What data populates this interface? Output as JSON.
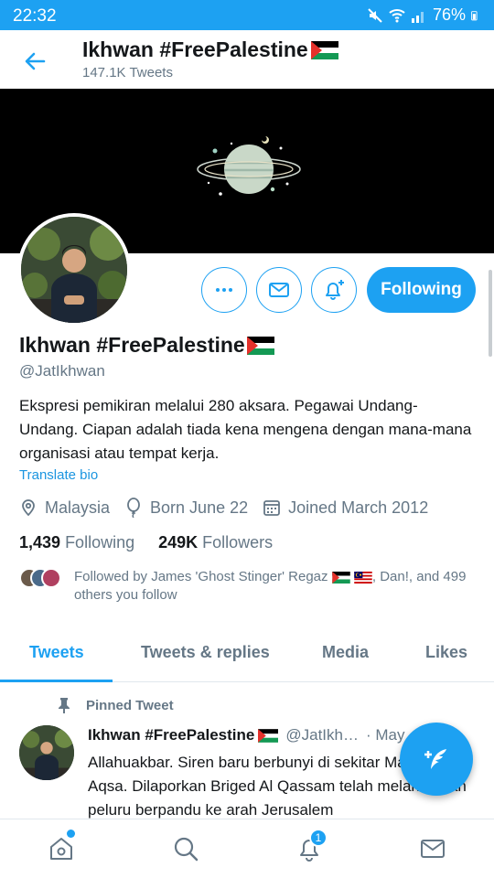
{
  "status_bar": {
    "time": "22:32",
    "battery": "76%"
  },
  "header": {
    "name": "Ikhwan #FreePalestine",
    "tweet_count": "147.1K Tweets"
  },
  "profile": {
    "name": "Ikhwan #FreePalestine",
    "handle": "@JatIkhwan",
    "bio": "Ekspresi pemikiran melalui 280 aksara. Pegawai Undang-Undang. Ciapan adalah tiada kena mengena dengan mana-mana organisasi atau tempat kerja.",
    "translate_label": "Translate bio",
    "location": "Malaysia",
    "birthday": "Born June 22",
    "joined": "Joined March 2012",
    "following_count": "1,439",
    "following_label": "Following",
    "followers_count": "249K",
    "followers_label": "Followers",
    "followed_by_prefix": "Followed by James 'Ghost Stinger' Regaz",
    "followed_by_suffix": ", Dan!, and 499 others you follow",
    "follow_button": "Following"
  },
  "tabs": [
    "Tweets",
    "Tweets & replies",
    "Media",
    "Likes"
  ],
  "pinned_tweet": {
    "label": "Pinned Tweet",
    "name": "Ikhwan #FreePalestine",
    "handle": "@JatIkh…",
    "date": "· May",
    "text": "Allahuakbar. Siren baru berbunyi di sekitar Masjid Al-Aqsa. Dilaporkan Briged Al Qassam telah melancarkan peluru berpandu ke arah Jerusalem"
  },
  "bottom_nav": {
    "notification_badge": "1"
  },
  "icons": {
    "back": "arrow-left-icon",
    "more": "more-horizontal-icon",
    "message": "envelope-icon",
    "notify": "bell-plus-icon",
    "location": "location-pin-icon",
    "birthday": "balloon-icon",
    "calendar": "calendar-icon",
    "pin": "pin-icon",
    "compose": "compose-feather-icon",
    "home": "home-icon",
    "search": "search-icon",
    "notifications": "bell-icon",
    "messages": "mail-icon"
  },
  "colors": {
    "accent": "#1da1f2",
    "secondary_text": "#657786",
    "primary_text": "#14171a"
  }
}
